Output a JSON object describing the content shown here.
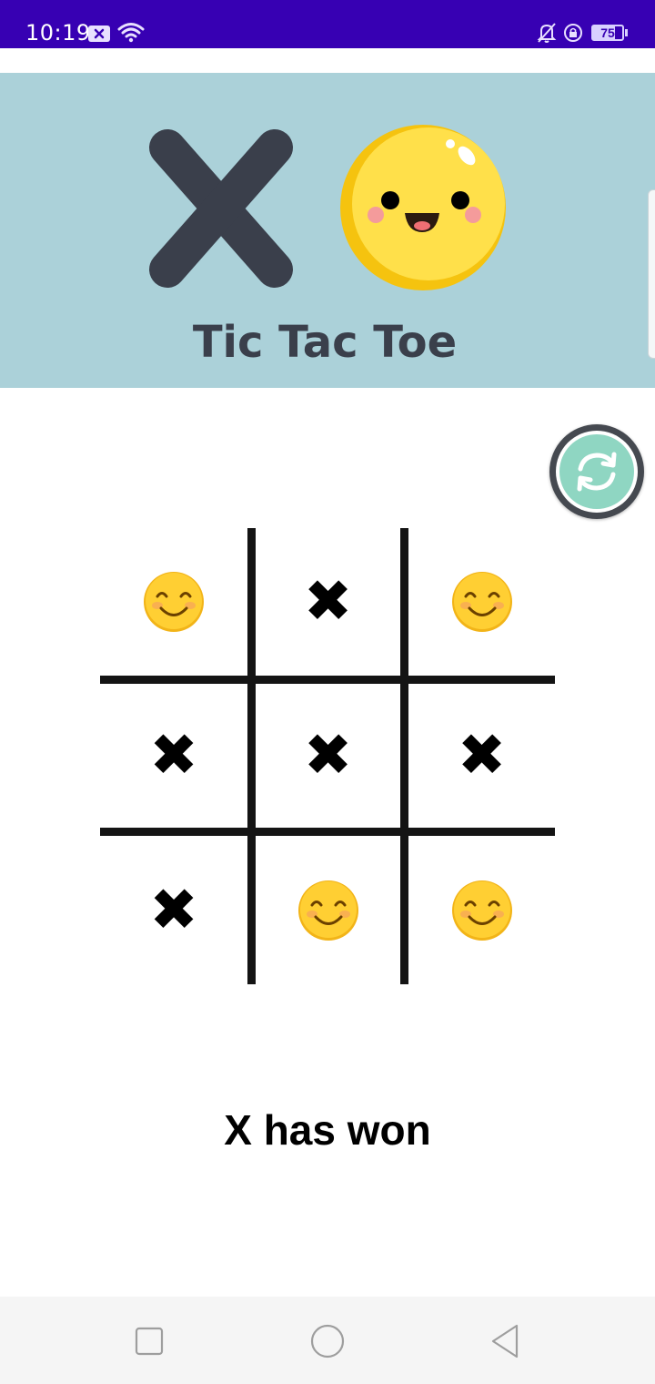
{
  "status_bar": {
    "time": "10:19",
    "battery": "75",
    "icons": [
      "notification-x-icon",
      "wifi-icon",
      "bell-off-icon",
      "lock-icon",
      "battery-icon"
    ]
  },
  "banner": {
    "title": "Tic Tac Toe",
    "logo_icons": [
      "x-logo-icon",
      "smiley-logo-icon"
    ],
    "colors": {
      "background": "#abd1d9",
      "dark": "#3a3f4b",
      "smiley": "#ffde3b"
    }
  },
  "reset_button": {
    "icon": "refresh-icon",
    "color": "#8fd6c2"
  },
  "board": {
    "cells": [
      [
        "O",
        "X",
        "O"
      ],
      [
        "X",
        "X",
        "X"
      ],
      [
        "X",
        "O",
        "O"
      ]
    ],
    "x_glyph": "✖",
    "o_icon": "smiling-face-icon"
  },
  "result_text": "X has won",
  "nav_bar": {
    "buttons": [
      "recent-apps-icon",
      "home-icon",
      "back-icon"
    ]
  }
}
